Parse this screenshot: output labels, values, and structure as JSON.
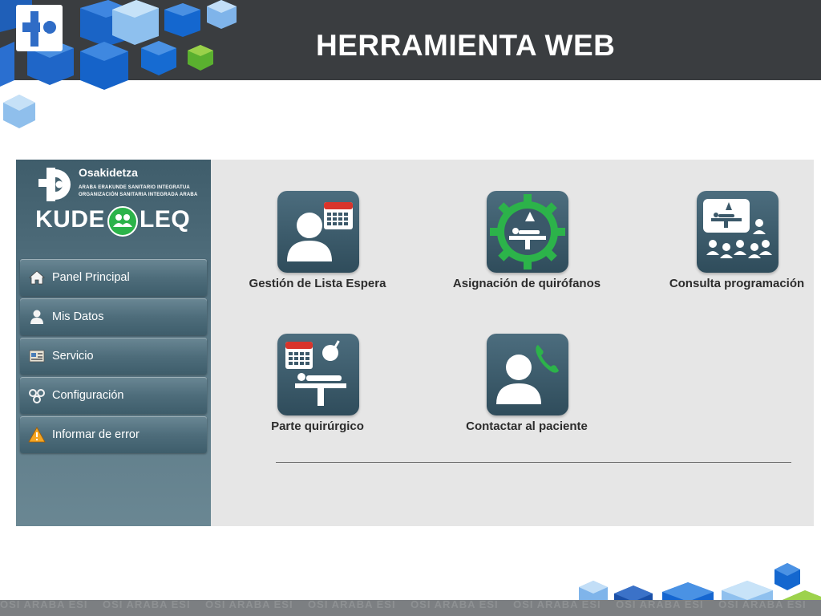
{
  "slide": {
    "title": "HERRAMIENTA WEB",
    "watermark": "OSI ARABA ESI"
  },
  "app": {
    "org": {
      "name": "Osakidetza",
      "line1": "ARABA ERAKUNDE SANITARIO INTEGRATUA",
      "line2": "ORGANIZACIÓN SANITARIA INTEGRADA ARABA"
    },
    "product": {
      "name_left": "KUDE",
      "name_right": "LEQ"
    },
    "menu": [
      {
        "label": "Panel Principal",
        "icon": "home-icon"
      },
      {
        "label": "Mis Datos",
        "icon": "user-icon"
      },
      {
        "label": "Servicio",
        "icon": "service-icon"
      },
      {
        "label": "Configuración",
        "icon": "gears-icon"
      },
      {
        "label": "Informar de error",
        "icon": "warning-icon"
      }
    ],
    "tiles": [
      {
        "label": "Gestión de Lista Espera",
        "icon": "user-calendar-icon"
      },
      {
        "label": "Asignación de quirófanos",
        "icon": "operating-room-gear-icon"
      },
      {
        "label": "Consulta programación",
        "icon": "operation-audience-icon"
      },
      {
        "label": "Parte quirúrgico",
        "icon": "surgery-report-icon"
      },
      {
        "label": "Contactar al paciente",
        "icon": "patient-phone-icon"
      }
    ]
  },
  "colors": {
    "banner": "#3a3d40",
    "sidebar": "#4e6d7b",
    "tile_icon_bg": "#3d5c6c",
    "accent_green": "#2cb34a",
    "calendar_red": "#d9342b"
  }
}
